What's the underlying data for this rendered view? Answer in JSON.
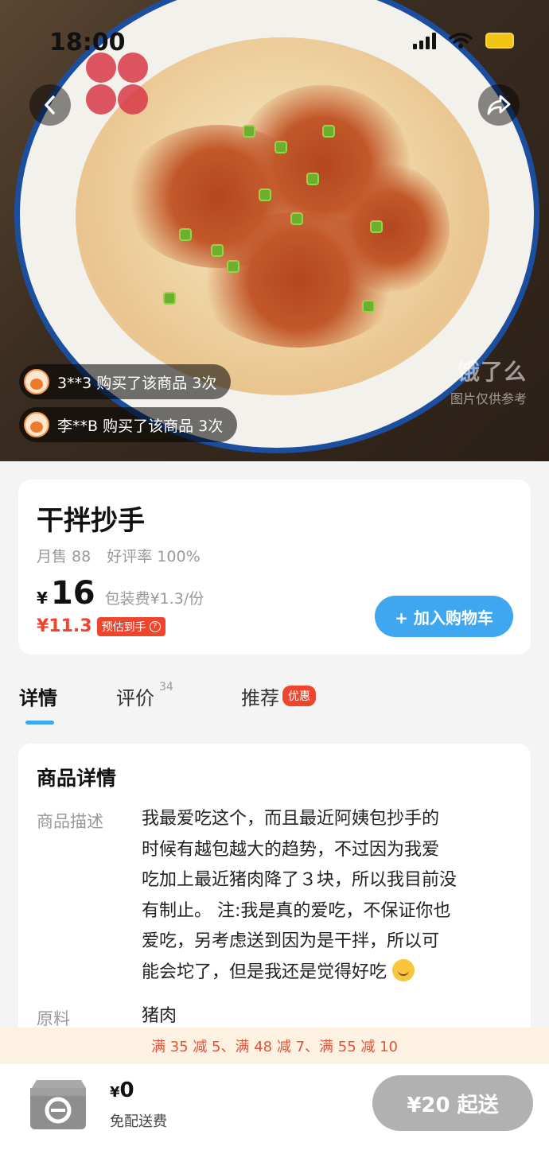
{
  "status_bar": {
    "time": "18:00"
  },
  "hero": {
    "watermark_brand": "饿了么",
    "watermark_note": "图片仅供参考",
    "buyers": [
      {
        "text": "3**3 购买了该商品 3次"
      },
      {
        "text": "李**B 购买了该商品 3次"
      }
    ]
  },
  "product": {
    "name": "干拌抄手",
    "monthly_sales": "月售 88",
    "rating": "好评率 100%",
    "currency": "¥",
    "price": "16",
    "packaging_fee": "包装费¥1.3/份",
    "estimated_price": "¥11.3",
    "estimated_tag": "预估到手",
    "add_to_cart": "+ 加入购物车"
  },
  "tabs": [
    {
      "label": "详情"
    },
    {
      "label": "评价",
      "count": "34"
    },
    {
      "label": "推荐",
      "badge": "优惠"
    }
  ],
  "details": {
    "title": "商品详情",
    "description_label": "商品描述",
    "description_lines": [
      "我最爱吃这个，而且最近阿姨包抄手的",
      "时候有越包越大的趋势，不过因为我爱",
      "吃加上最近猪肉降了３块，所以我目前没",
      "有制止。 注:我是真的爱吃，不保证你也",
      "爱吃，另考虑送到因为是干拌，所以可",
      "能会坨了，但是我还是觉得好吃"
    ],
    "ingredients_label": "原料",
    "ingredients_value": "猪肉"
  },
  "promo": {
    "text": "满 35 减 5、满 48 减 7、满 55 减 10"
  },
  "bottom_bar": {
    "cart_currency": "¥",
    "cart_total": "0",
    "delivery": "免配送费",
    "checkout": "¥20 起送"
  },
  "colors": {
    "accent_blue": "#3fa6f0",
    "price_red": "#f0452d",
    "promo_bg": "#fdf1e1",
    "checkout_disabled": "#b1b1b1"
  }
}
